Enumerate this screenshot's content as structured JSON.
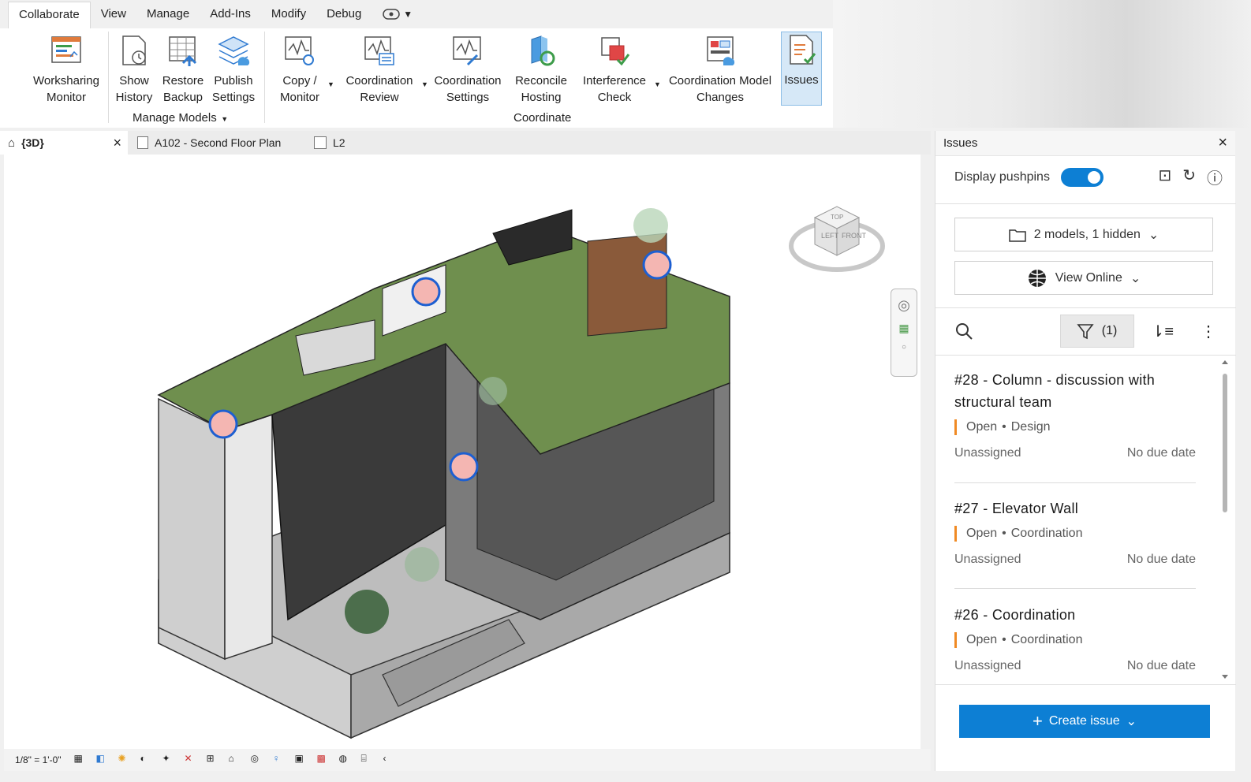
{
  "ribbon": {
    "tabs": [
      "Collaborate",
      "View",
      "Manage",
      "Add-Ins",
      "Modify",
      "Debug"
    ],
    "active_tab": "Collaborate",
    "tools": {
      "worksharing": [
        "Worksharing",
        "Monitor"
      ],
      "show_history": [
        "Show",
        "History"
      ],
      "restore_backup": [
        "Restore",
        "Backup"
      ],
      "publish_settings": [
        "Publish",
        "Settings"
      ],
      "copy_monitor": [
        "Copy /",
        "Monitor"
      ],
      "coordination_review": [
        "Coordination",
        "Review"
      ],
      "coordination_settings": [
        "Coordination",
        "Settings"
      ],
      "reconcile_hosting": [
        "Reconcile",
        "Hosting"
      ],
      "interference_check": [
        "Interference",
        "Check"
      ],
      "coordination_model_changes": [
        "Coordination Model",
        "Changes"
      ],
      "issues": [
        "Issues"
      ]
    },
    "groups": {
      "manage_models": "Manage Models",
      "coordinate": "Coordinate"
    }
  },
  "view_tabs": [
    {
      "label": "{3D}",
      "active": true
    },
    {
      "label": "A102 - Second Floor Plan",
      "active": false
    },
    {
      "label": "L2",
      "active": false
    }
  ],
  "viewcube": {
    "left": "LEFT",
    "front": "FRONT",
    "top": "TOP"
  },
  "statusbar": {
    "scale": "1/8\" = 1'-0\""
  },
  "issues_panel": {
    "title": "Issues",
    "display_pushpins": "Display pushpins",
    "pushpins_on": true,
    "models_dropdown": "2 models, 1 hidden",
    "view_online": "View Online",
    "filter_count": "(1)",
    "items": [
      {
        "title": "#28 - Column - discussion with structural team",
        "status": "Open",
        "type": "Design",
        "assignee": "Unassigned",
        "due": "No due date"
      },
      {
        "title": "#27 - Elevator Wall",
        "status": "Open",
        "type": "Coordination",
        "assignee": "Unassigned",
        "due": "No due date"
      },
      {
        "title": "#26 - Coordination",
        "status": "Open",
        "type": "Coordination",
        "assignee": "Unassigned",
        "due": "No due date"
      }
    ],
    "create_button": "Create issue"
  },
  "colors": {
    "accent": "#0d7fd4",
    "status_open": "#f08a24",
    "pushpin": "#f4b6b2"
  }
}
